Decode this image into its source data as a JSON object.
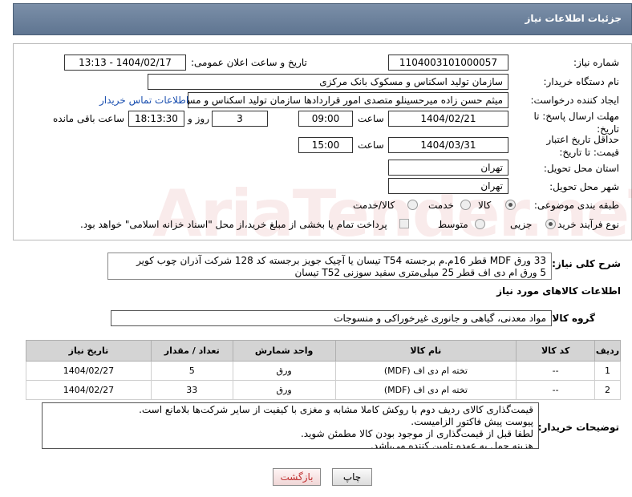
{
  "header": {
    "title": "جزئیات اطلاعات نیاز"
  },
  "fields": {
    "need_number_label": "شماره نیاز:",
    "need_number": "1104003101000057",
    "announce_label": "تاریخ و ساعت اعلان عمومی:",
    "announce_value": "1404/02/17 - 13:13",
    "buyer_org_label": "نام دستگاه خریدار:",
    "buyer_org": "سازمان تولید اسکناس و مسکوک بانک مرکزی",
    "creator_label": "ایجاد کننده درخواست:",
    "creator": "میثم حسن زاده میرحسینلو متصدی امور قراردادها سازمان تولید اسکناس و مس",
    "contact_link": "اطلاعات تماس خریدار",
    "deadline_label": "مهلت ارسال پاسخ: تا تاریخ:",
    "deadline_date": "1404/02/21",
    "time_label": "ساعت",
    "deadline_time": "09:00",
    "days_value": "3",
    "days_label": "روز و",
    "remaining_time": "18:13:30",
    "remaining_label": "ساعت باقی مانده",
    "validity_label": "حداقل تاریخ اعتبار قیمت: تا تاریخ:",
    "validity_date": "1404/03/31",
    "validity_time": "15:00",
    "province_label": "استان محل تحویل:",
    "province": "تهران",
    "city_label": "شهر محل تحویل:",
    "city": "تهران",
    "category_label": "طبقه بندی موضوعی:",
    "category_options": [
      "کالا",
      "خدمت",
      "کالا/خدمت"
    ],
    "category_selected": "کالا",
    "process_label": "نوع فرآیند خرید :",
    "process_options": [
      "جزیی",
      "متوسط"
    ],
    "process_selected": "جزیی",
    "treasury_note": "پرداخت تمام یا بخشی از مبلغ خرید،از محل \"اسناد خزانه اسلامی\" خواهد بود."
  },
  "description": {
    "label": "شرح کلی نیاز:",
    "lines": [
      "33 ورق MDF قطر 16م.م برجسته T54 تیسان یا آچیک جویز برجسته کد 128 شرکت آذران چوب کویر",
      "5 ورق ام دی اف قطر 25 میلی‌متری سفید سوزنی T52 تیسان"
    ]
  },
  "goods_section": {
    "title": "اطلاعات کالاهای مورد نیاز"
  },
  "goods_group": {
    "label": "گروه کالا:",
    "value": "مواد معدنی، گیاهی و جانوری غیرخوراکی و منسوجات"
  },
  "table": {
    "headers": [
      "ردیف",
      "کد کالا",
      "نام کالا",
      "واحد شمارش",
      "تعداد / مقدار",
      "تاریخ نیاز"
    ],
    "rows": [
      [
        "1",
        "--",
        "تخته ام دی اف (MDF)",
        "ورق",
        "5",
        "1404/02/27"
      ],
      [
        "2",
        "--",
        "تخته ام دی اف (MDF)",
        "ورق",
        "33",
        "1404/02/27"
      ]
    ]
  },
  "notes": {
    "label": "توضیحات خریدار:",
    "lines": [
      "قیمت‌گذاری کالای ردیف دوم با روکش کاملا مشابه و مغزی با کیفیت از سایر شرکت‌ها بلامانع است.",
      "پیوست پیش فاکتور الزامیست.",
      "لطفا قبل از قیمت‌گذاری از موجود بودن کالا مطمئن شوید.",
      "هزینه حمل به عهده تامین کننده می‌باشد."
    ]
  },
  "buttons": {
    "print": "چاپ",
    "back": "بازگشت"
  },
  "watermark": "AriaTender.neT"
}
